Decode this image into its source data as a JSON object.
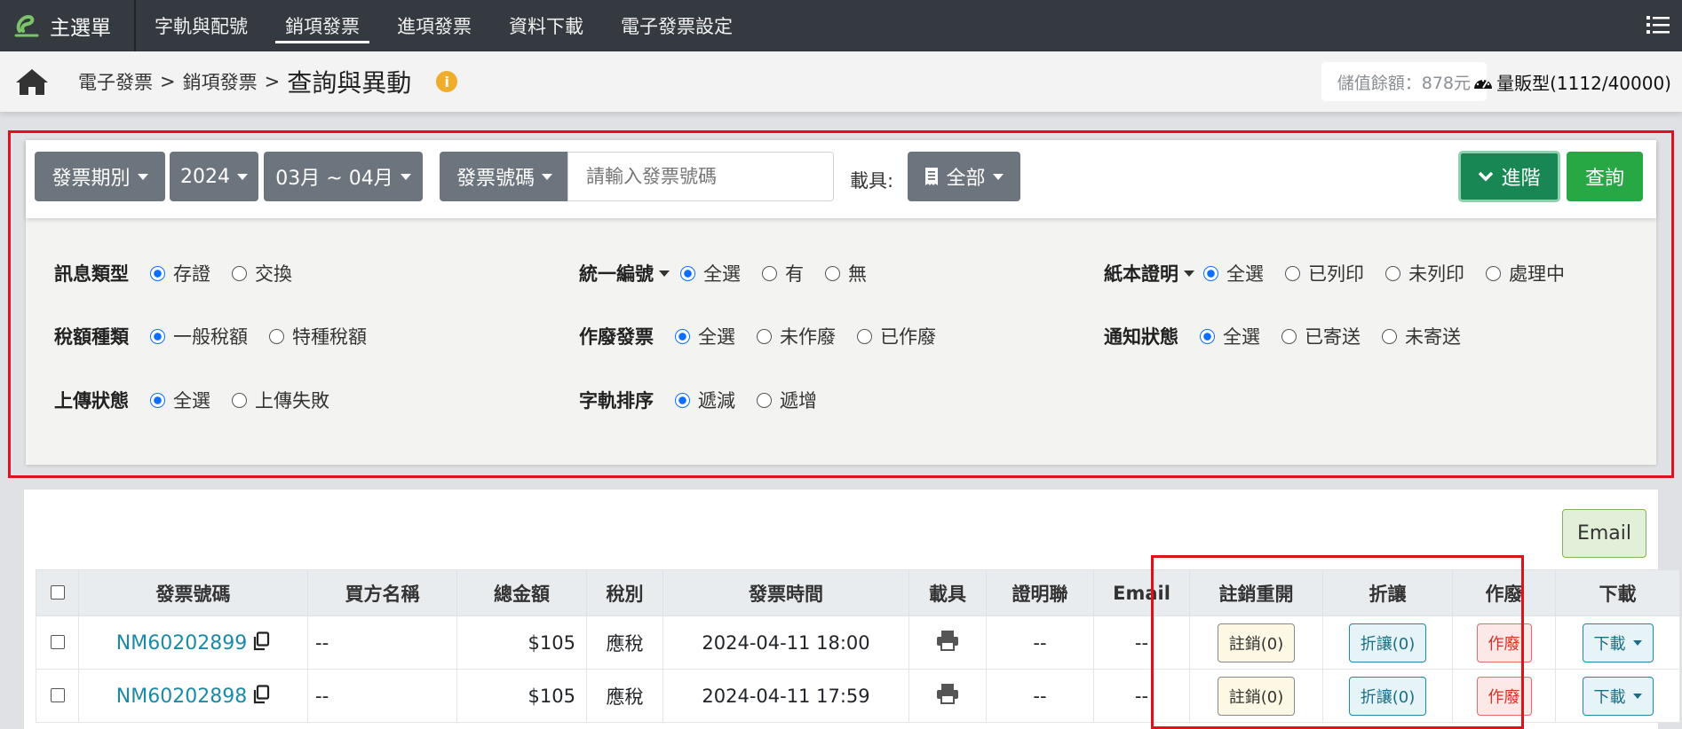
{
  "nav": {
    "brand": "主選單",
    "items": [
      {
        "label": "字軌與配號",
        "active": false
      },
      {
        "label": "銷項發票",
        "active": true
      },
      {
        "label": "進項發票",
        "active": false
      },
      {
        "label": "資料下載",
        "active": false
      },
      {
        "label": "電子發票設定",
        "active": false
      }
    ],
    "menu_icon": "hamburger-list-icon"
  },
  "breadcrumb": {
    "home_icon": "home-icon",
    "level1": "電子發票",
    "sep1": ">",
    "level2": "銷項發票",
    "sep2": ">",
    "current": "查詢與異動",
    "info_icon": "i"
  },
  "account": {
    "balance": "儲值餘額：878元",
    "plan": "量販型(1112/40000)",
    "plan_icon": "speedometer-icon"
  },
  "filters": {
    "period_type": "發票期別",
    "year": "2024",
    "months": "03月 ~ 04月",
    "search_field": "發票號碼",
    "search_placeholder": "請輸入發票號碼",
    "carrier_label": "載具:",
    "carrier_value": "全部",
    "advanced_label": "進階",
    "query_label": "查詢"
  },
  "advanced": {
    "message_type": {
      "label": "訊息類型",
      "options": [
        "存證",
        "交換"
      ],
      "selected": 0
    },
    "tax_id": {
      "label": "統一編號",
      "options": [
        "全選",
        "有",
        "無"
      ],
      "selected": 0
    },
    "paper_proof": {
      "label": "紙本證明",
      "options": [
        "全選",
        "已列印",
        "未列印",
        "處理中"
      ],
      "selected": 0
    },
    "tax_type": {
      "label": "稅額種類",
      "options": [
        "一般稅額",
        "特種稅額"
      ],
      "selected": 0
    },
    "void_invoice": {
      "label": "作廢發票",
      "options": [
        "全選",
        "未作廢",
        "已作廢"
      ],
      "selected": 0
    },
    "notify_status": {
      "label": "通知狀態",
      "options": [
        "全選",
        "已寄送",
        "未寄送"
      ],
      "selected": 0
    },
    "upload_status": {
      "label": "上傳狀態",
      "options": [
        "全選",
        "上傳失敗"
      ],
      "selected": 0
    },
    "track_sort": {
      "label": "字軌排序",
      "options": [
        "遞減",
        "遞增"
      ],
      "selected": 0
    }
  },
  "results": {
    "email_button": "Email",
    "columns": [
      "發票號碼",
      "買方名稱",
      "總金額",
      "稅別",
      "發票時間",
      "載具",
      "證明聯",
      "Email",
      "註銷重開",
      "折讓",
      "作廢",
      "下載"
    ],
    "rows": [
      {
        "invoice_no": "NM60202899",
        "buyer": "--",
        "amount": "$105",
        "tax": "應稅",
        "time": "2024-04-11 18:00",
        "proof": "--",
        "email": "--",
        "cancel": "註銷(0)",
        "allowance": "折讓(0)",
        "void": "作廢",
        "download": "下載"
      },
      {
        "invoice_no": "NM60202898",
        "buyer": "--",
        "amount": "$105",
        "tax": "應稅",
        "time": "2024-04-11 17:59",
        "proof": "--",
        "email": "--",
        "cancel": "註銷(0)",
        "allowance": "折讓(0)",
        "void": "作廢",
        "download": "下載"
      }
    ]
  }
}
